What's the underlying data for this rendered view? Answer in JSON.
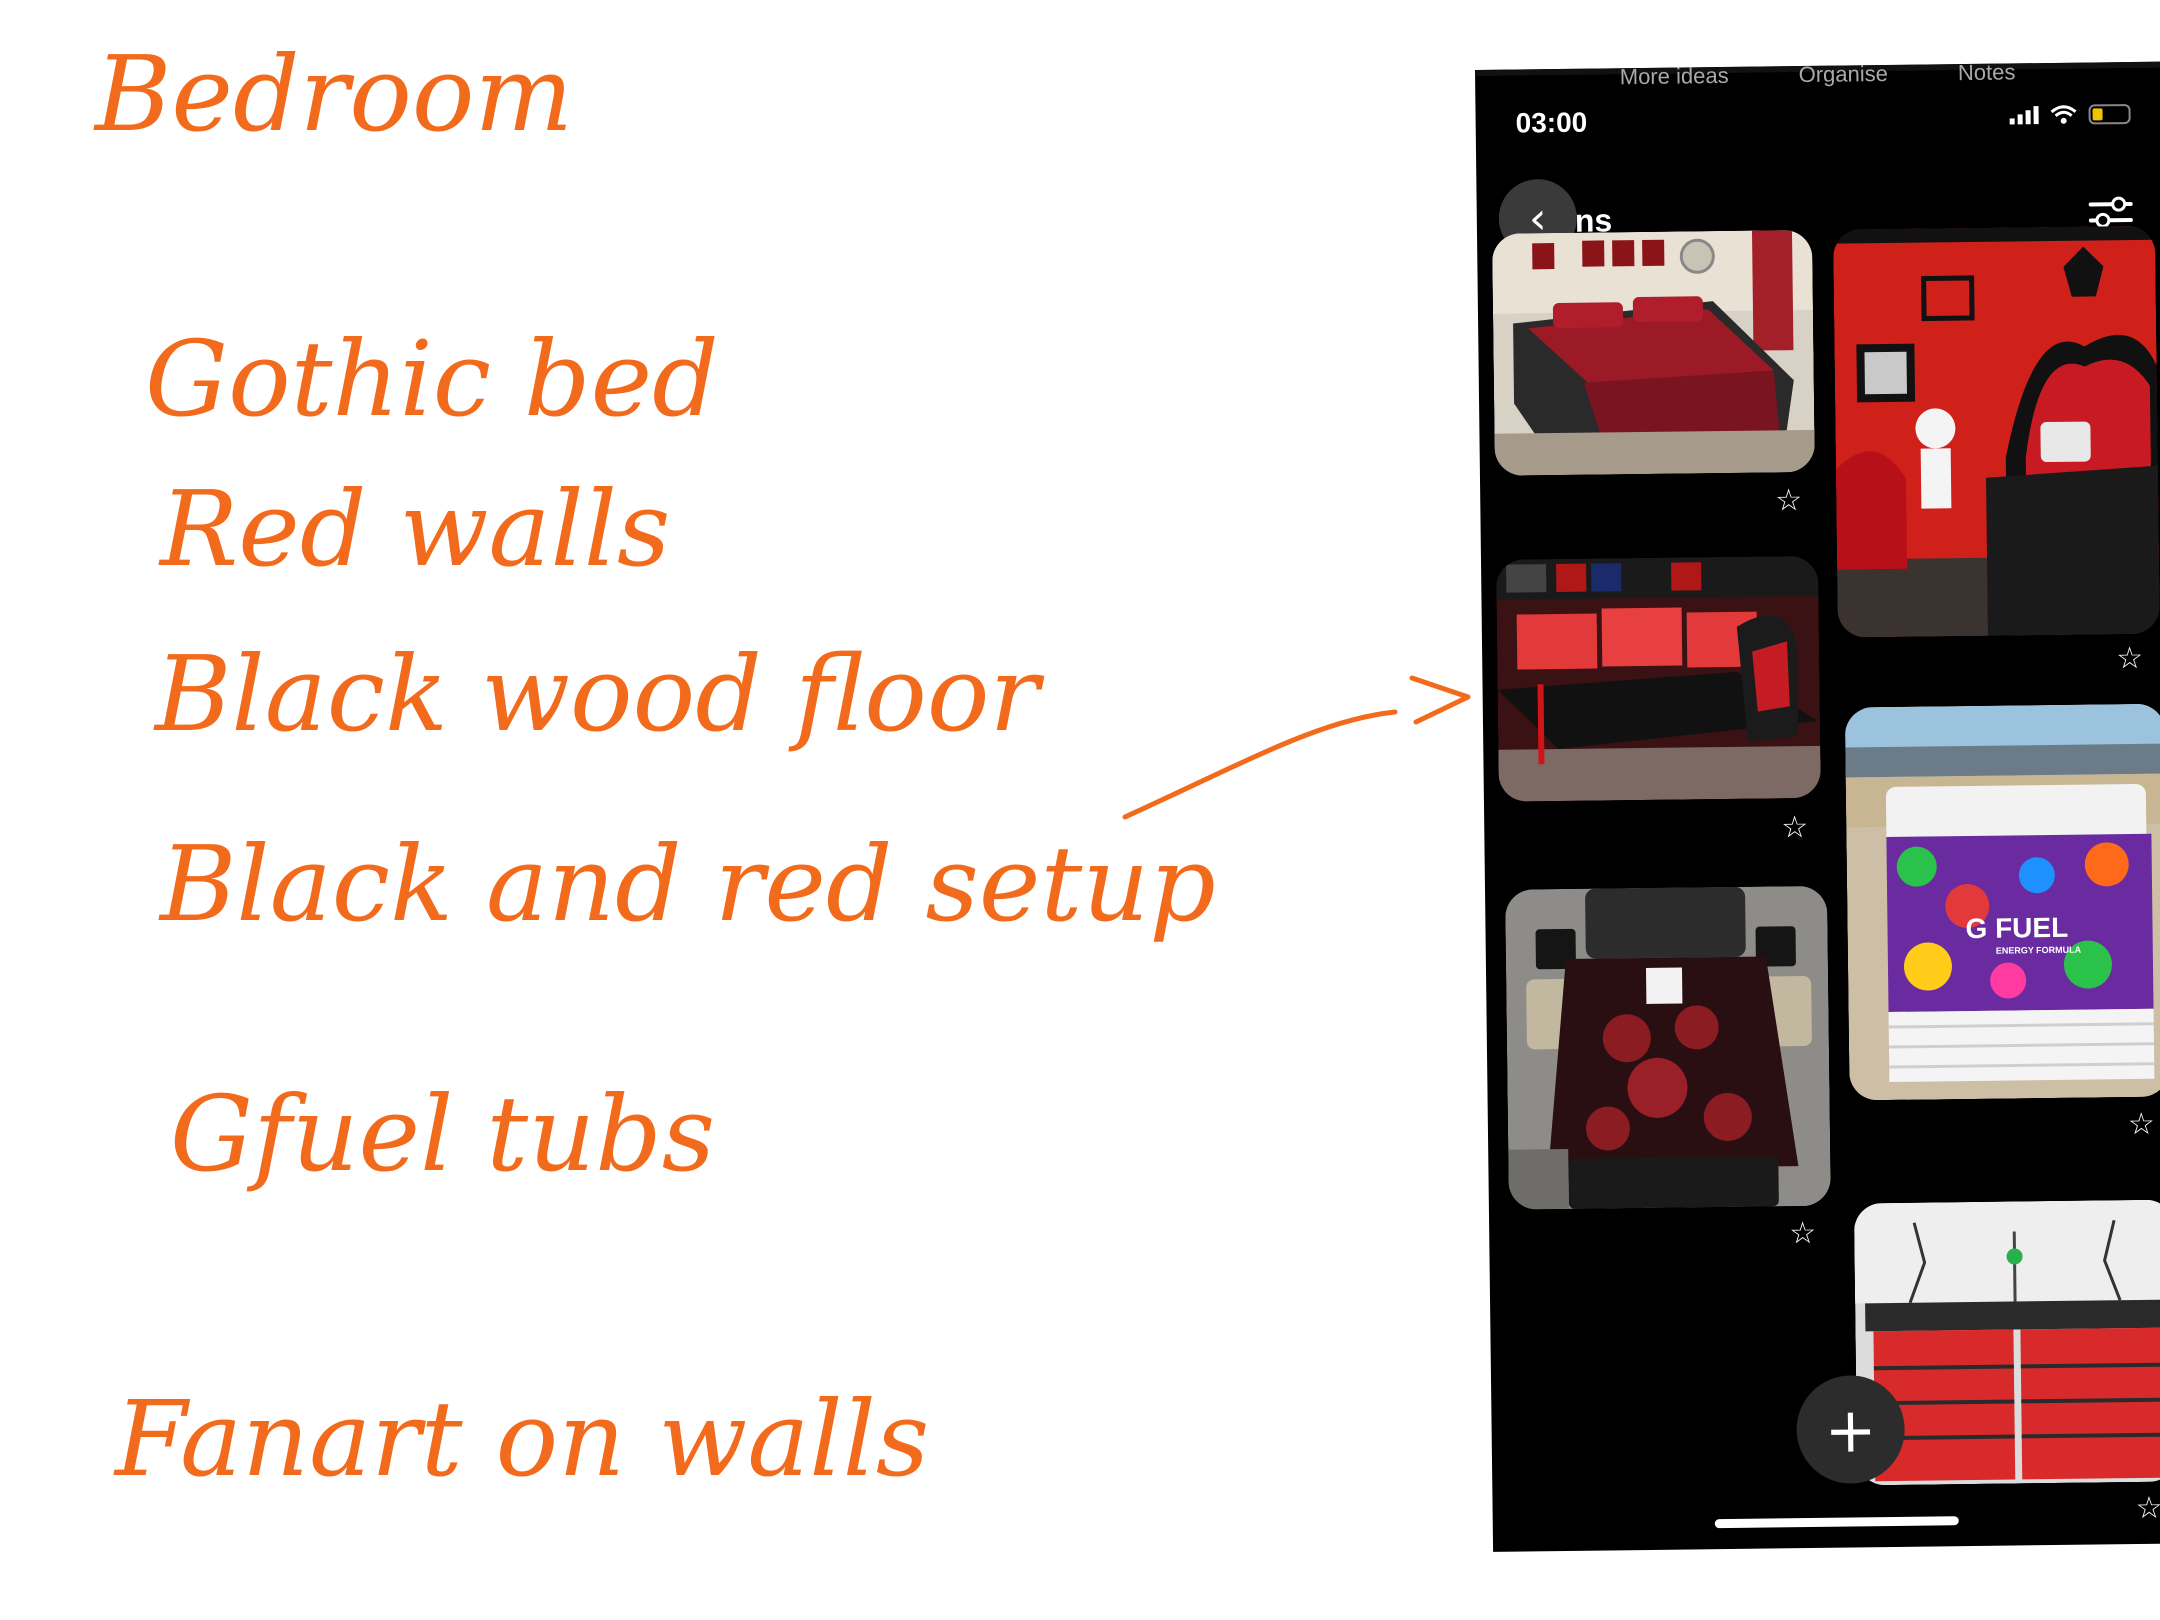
{
  "notes": {
    "title": "Bedroom",
    "items": [
      "Gothic bed",
      "Red walls",
      "Black wood floor",
      "Black and red setup",
      "Gfuel tubs",
      "Fanart on walls"
    ]
  },
  "phone": {
    "top_tabs": [
      "More ideas",
      "Organise",
      "Notes"
    ],
    "time": "03:00",
    "header_title": "ns",
    "back_icon": "chevron-left-icon",
    "filter_icon": "sliders-icon",
    "add_icon": "plus-icon",
    "add_symbol": "+",
    "back_symbol": "‹",
    "star_symbol": "☆",
    "pins": [
      {
        "label": "Red and black bedding set"
      },
      {
        "label": "Red gothic bedroom"
      },
      {
        "label": "Red gaming setup"
      },
      {
        "label": "G FUEL cooler"
      },
      {
        "label": "Skull comforter bedroom"
      },
      {
        "label": "Red and black dresser"
      }
    ],
    "cooler_brand": "G FUEL",
    "cooler_sub": "ENERGY FORMULA"
  },
  "colors": {
    "ink": "#f26b1d",
    "phone_bg": "#000000",
    "accent_red": "#d22020"
  }
}
